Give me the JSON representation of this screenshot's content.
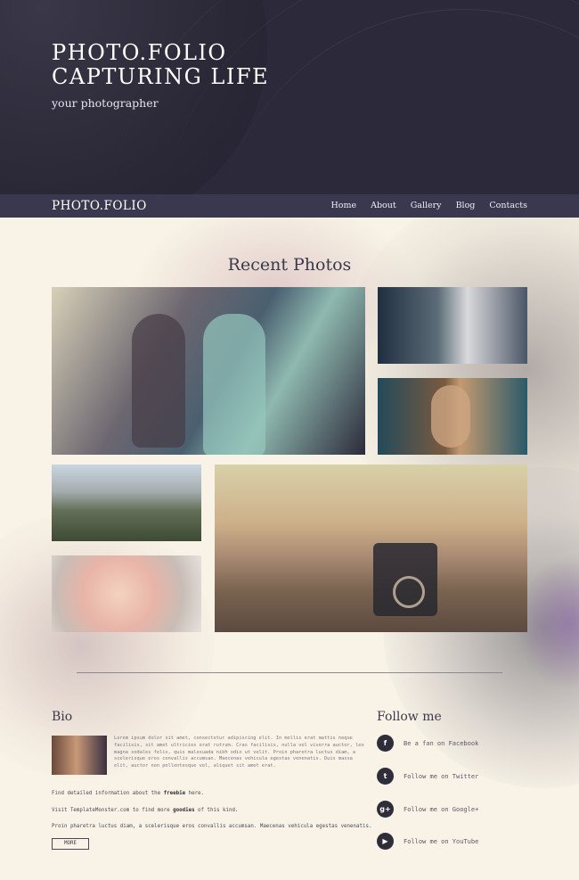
{
  "hero": {
    "title_line1": "PHOTO.FOLIO",
    "title_line2": "CAPTURING LIFE",
    "subtitle": "your photographer"
  },
  "nav": {
    "brand": "PHOTO.FOLIO",
    "items": [
      "Home",
      "About",
      "Gallery",
      "Blog",
      "Contacts"
    ]
  },
  "gallery": {
    "title": "Recent Photos"
  },
  "bio": {
    "title": "Bio",
    "text": "Lorem ipsum dolor sit amet, consectetur adipiscing elit. In mollis erat mattis neque facilisis, sit amet ultricies erat rutrum. Cras facilisis, nulla vel viverra auctor, leo magna sodales felis, quis malesuada nibh odio ut velit. Proin pharetra luctus diam, a scelerisque eros convallis accumsan. Maecenas vehicula egestas venenatis. Duis massa elit, auctor non pellentesque vel, aliquet sit amet erat.",
    "line1_pre": "Find detailed information about the ",
    "line1_bold": "freebie",
    "line1_post": " here.",
    "line2_pre": "Visit TemplateMonster.com to find more ",
    "line2_bold": "goodies",
    "line2_post": " of this kind.",
    "line3": "Proin pharetra luctus diam, a scelerisque eros convallis accumsan. Maecenas vehicula egestas venenatis.",
    "more_label": "MORE"
  },
  "follow": {
    "title": "Follow me",
    "items": [
      {
        "icon": "facebook-icon",
        "glyph": "f",
        "label": "Be a fan on Facebook"
      },
      {
        "icon": "twitter-icon",
        "glyph": "t",
        "label": "Follow me on Twitter"
      },
      {
        "icon": "google-plus-icon",
        "glyph": "g+",
        "label": "Follow me on Google+"
      },
      {
        "icon": "youtube-icon",
        "glyph": "▶",
        "label": "Follow me on YouTube"
      }
    ]
  }
}
